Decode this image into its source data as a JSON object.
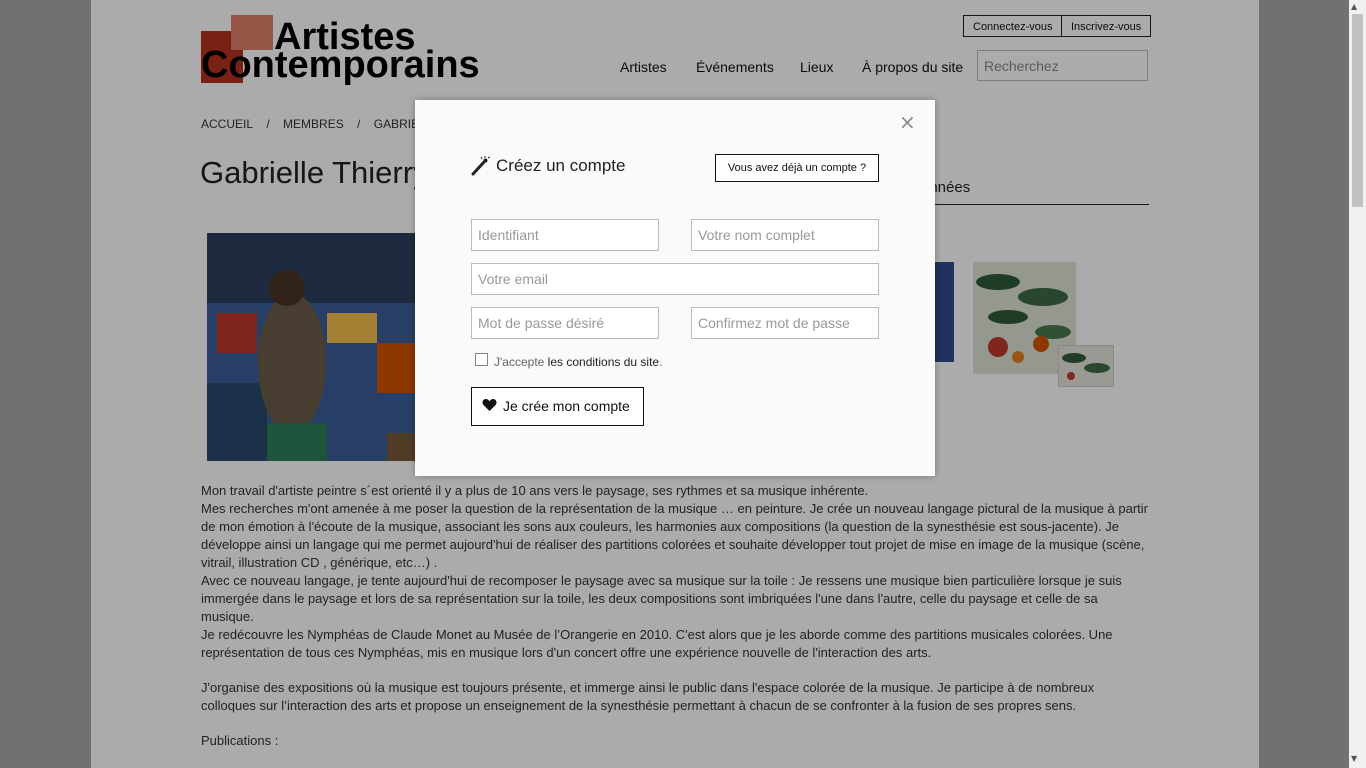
{
  "logo": {
    "line1": "Artistes",
    "line2": "Contemporains",
    "colors": [
      "#b5321f",
      "#e0806a"
    ]
  },
  "header": {
    "login_label": "Connectez-vous",
    "signup_label": "Inscrivez-vous",
    "nav": [
      "Artistes",
      "Événements",
      "Lieux",
      "À propos du site"
    ],
    "search_placeholder": "Recherchez"
  },
  "breadcrumb": [
    "ACCUEIL",
    "/",
    "MEMBRES",
    "/",
    "GABRIELLE T"
  ],
  "profile": {
    "name": "Gabrielle Thierry",
    "tab_label": "onnées"
  },
  "bio": [
    "Mon travail d'artiste peintre s´est orienté il y a plus de 10 ans vers le paysage, ses rythmes et sa musique inhérente.",
    "Mes recherches m'ont amenée à me poser la question de la représentation de la musique … en peinture. Je crée un nouveau langage pictural de la musique à partir de mon émotion à l'écoute de la musique, associant les sons aux couleurs, les harmonies aux compositions (la question de la synesthésie est sous-jacente). Je développe ainsi un langage qui me permet aujourd'hui de réaliser des partitions colorées et souhaite développer tout projet de mise en image de la musique (scène, vitrail, illustration CD , générique, etc…) .",
    "Avec ce nouveau langage, je tente aujourd'hui de recomposer le paysage avec sa musique sur la toile : Je ressens une musique bien particulière lorsque je suis immergée dans le paysage et lors de sa représentation sur la toile, les deux compositions sont imbriquées l'une dans l'autre, celle du paysage et celle de sa musique.",
    "Je redécouvre les Nymphéas de Claude Monet au Musée de l’Orangerie en 2010. C'est alors que je les aborde comme des partitions musicales colorées. Une représentation de tous ces Nymphéas, mis en musique lors d'un concert offre une expérience nouvelle de l'interaction des arts.",
    "J'organise des expositions où la musique est toujours présente, et immerge ainsi le public dans l'espace colorée de la musique. Je participe à de nombreux colloques sur l’interaction des arts et propose un enseignement de la synesthésie permettant à chacun de se confronter à la fusion de ses propres sens.",
    "Publications :"
  ],
  "modal": {
    "title": "Créez un compte",
    "have_account_label": "Vous avez déjà un compte ?",
    "close_label": "×",
    "fields": {
      "username_placeholder": "Identifiant",
      "fullname_placeholder": "Votre nom complet",
      "email_placeholder": "Votre email",
      "password_placeholder": "Mot de passe désiré",
      "confirm_placeholder": "Confirmez mot de passe"
    },
    "terms_prefix": "J'accepte",
    "terms_link": "les conditions du site",
    "terms_suffix": ".",
    "submit_label": "Je crée mon compte"
  }
}
